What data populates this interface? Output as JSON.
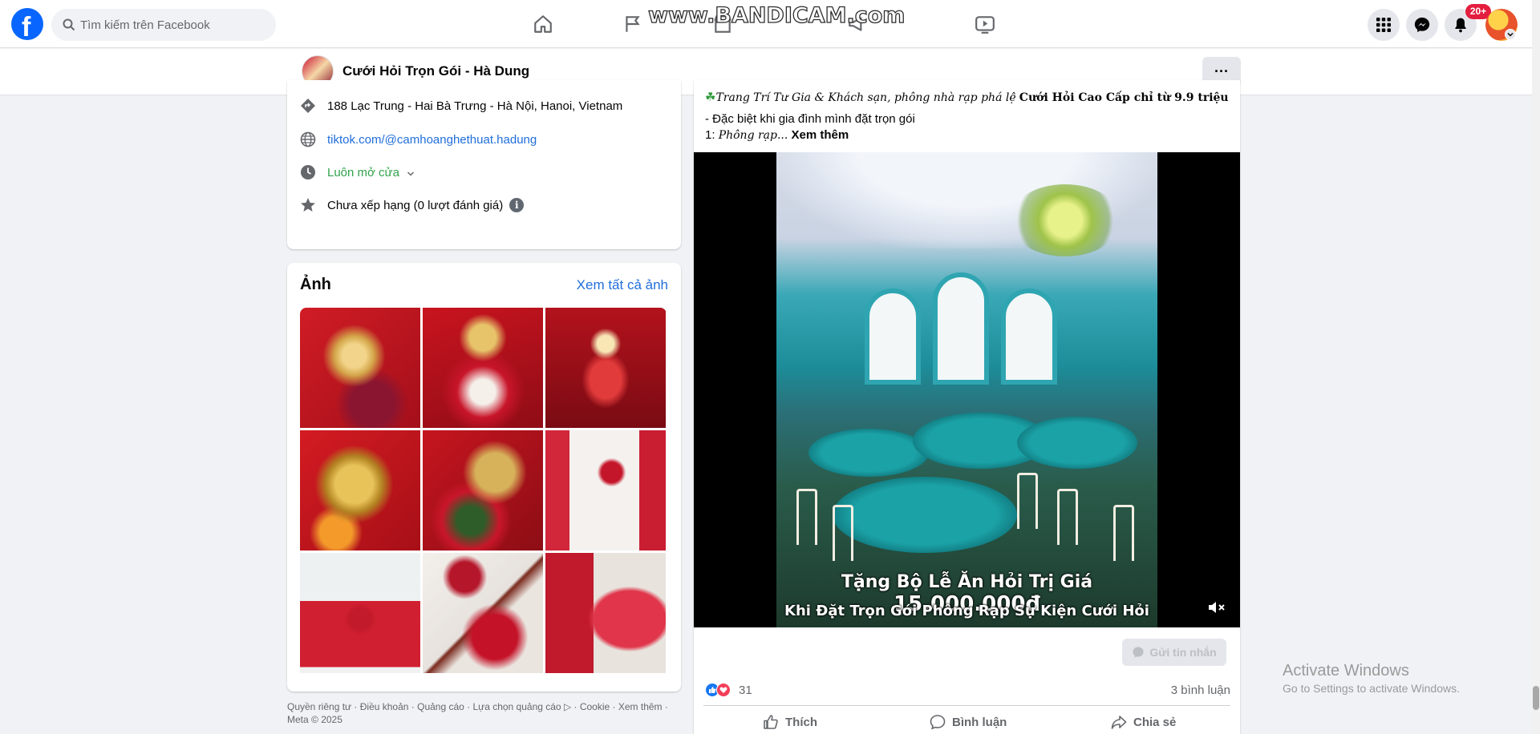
{
  "topbar": {
    "logo_letter": "f",
    "search_placeholder": "Tìm kiếm trên Facebook",
    "watermark": "www.BANDICAM.com",
    "notification_badge": "20+"
  },
  "page_header": {
    "name": "Cưới Hỏi Trọn Gói - Hà Dung",
    "more_label": "···"
  },
  "intro": {
    "address": "188 Lạc Trung - Hai Bà Trưng - Hà Nội, Hanoi, Vietnam",
    "website": "tiktok.com/@camhoanghethuat.hadung",
    "hours": "Luôn mở cửa",
    "rating": "Chưa xếp hạng (0 lượt đánh giá)",
    "info_glyph": "i"
  },
  "photos": {
    "title": "Ảnh",
    "see_all": "Xem tất cả ảnh"
  },
  "footer": {
    "text": "Quyền riêng tư · Điều khoản · Quảng cáo · Lựa chọn quảng cáo ▷ · Cookie · Xem thêm · Meta © 2025"
  },
  "post": {
    "line1_italic": "Trang Trí Tư Gia & Khách sạn, phông nhà rạp phá lệ",
    "line1_bold": "Cưới Hỏi Cao Cấp chỉ từ 9.9 triệu",
    "line2": "- Đặc biệt khi gia đình mình đặt trọn gói",
    "line3_prefix": "1:",
    "line3_italic": "Phông rạp...",
    "see_more": "Xem thêm",
    "video_caption_prefix": "Tặng Bộ Lễ Ăn Hỏi Trị Giá",
    "video_caption_amount": "15.000.000đ",
    "video_caption_line2": "Khi Đặt Trọn Gói Phông Rạp Sự Kiện Cưới Hỏi",
    "mute_glyph": "🔇",
    "send_message": "Gửi tin nhắn",
    "reaction_count": "31",
    "comment_count": "3 bình luận",
    "actions": {
      "like": "Thích",
      "comment": "Bình luận",
      "share": "Chia sẻ"
    }
  },
  "windows": {
    "activate_title": "Activate Windows",
    "activate_sub": "Go to Settings to activate Windows."
  },
  "colors": {
    "brand": "#0866ff",
    "link": "#216fdb",
    "open_status": "#31a24c",
    "badge": "#e41e3f"
  }
}
